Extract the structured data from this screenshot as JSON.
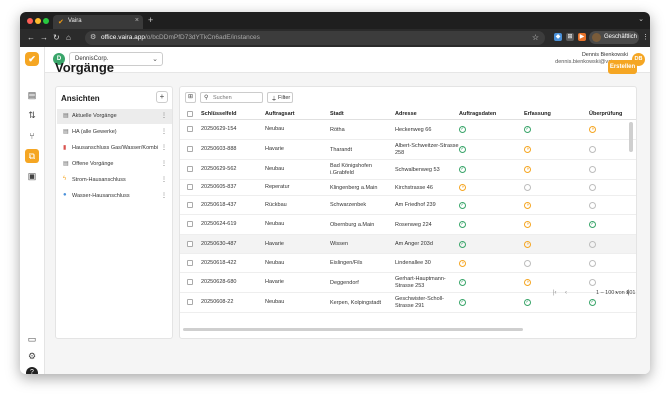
{
  "browser": {
    "tab_title": "Vaira",
    "url_host": "office.vaira.app",
    "url_path": "/o/bcDDmPfD73dYTkCn6adE/instances",
    "profile_label": "Geschäftlich"
  },
  "app": {
    "org_initial": "D",
    "org_name": "DennisCorp.",
    "user_name": "Dennis Bienkowski",
    "user_email": "dennis.bienkowski@vaira.app",
    "user_initials": "DB",
    "page_title": "Vorgänge",
    "create_label": "Erstellen"
  },
  "views": {
    "title": "Ansichten",
    "items": [
      {
        "label": "Aktuelle Vorgänge",
        "icon": "table-icon"
      },
      {
        "label": "HA (alle Gewerke)",
        "icon": "table-icon"
      },
      {
        "label": "Hausanschluss Gas/Wasser/Kombi",
        "icon": "utility-icon"
      },
      {
        "label": "Offene Vorgänge",
        "icon": "table-icon"
      },
      {
        "label": "Strom-Hausanschluss",
        "icon": "bolt-icon"
      },
      {
        "label": "Wasser-Hausanschluss",
        "icon": "drop-icon"
      }
    ]
  },
  "table": {
    "search_placeholder": "Suchen",
    "filter_label": "Filter",
    "columns": [
      "Schlüsselfeld",
      "Auftragsart",
      "Stadt",
      "Adresse",
      "Auftragsdaten",
      "Erfassung",
      "Überprüfung"
    ],
    "rows": [
      {
        "key": "20250629-154",
        "type": "Neubau",
        "city": [
          "Rötha"
        ],
        "address": [
          "Heckenweg 66"
        ],
        "s1": "done",
        "s2": "done",
        "s3": "progress"
      },
      {
        "key": "20250603-888",
        "type": "Havarie",
        "city": [
          "Tharandt"
        ],
        "address": [
          "Albert-Schweitzer-Strasse",
          "258"
        ],
        "s1": "done",
        "s2": "progress",
        "s3": "open"
      },
      {
        "key": "20250629-562",
        "type": "Neubau",
        "city": [
          "Bad Königshofen",
          "i.Grabfeld"
        ],
        "address": [
          "Schwalbenweg 53"
        ],
        "s1": "done",
        "s2": "progress",
        "s3": "open"
      },
      {
        "key": "20250605-837",
        "type": "Reperatur",
        "city": [
          "Klingenberg a.Main"
        ],
        "address": [
          "Kirchstrasse 46"
        ],
        "s1": "progress",
        "s2": "open",
        "s3": "open"
      },
      {
        "key": "20250618-437",
        "type": "Rückbau",
        "city": [
          "Schwarzenbek"
        ],
        "address": [
          "Am Friedhof 239"
        ],
        "s1": "done",
        "s2": "progress",
        "s3": "open"
      },
      {
        "key": "20250624-619",
        "type": "Neubau",
        "city": [
          "Obernburg a.Main"
        ],
        "address": [
          "Rosenweg 224"
        ],
        "s1": "done",
        "s2": "progress",
        "s3": "done"
      },
      {
        "key": "20250630-487",
        "type": "Havarie",
        "city": [
          "Wissen"
        ],
        "address": [
          "Am Anger 203d"
        ],
        "s1": "done",
        "s2": "progress",
        "s3": "open"
      },
      {
        "key": "20250618-422",
        "type": "Neubau",
        "city": [
          "Eislingen/Fils"
        ],
        "address": [
          "Lindenallee 30"
        ],
        "s1": "progress",
        "s2": "open",
        "s3": "open"
      },
      {
        "key": "20250628-680",
        "type": "Havarie",
        "city": [
          "Deggendorf"
        ],
        "address": [
          "Gerhart-Hauptmann-",
          "Strasse 253"
        ],
        "s1": "done",
        "s2": "progress",
        "s3": "open"
      },
      {
        "key": "20250608-22",
        "type": "Neubau",
        "city": [
          "Kerpen, Kolpingstadt"
        ],
        "address": [
          "Geschwister-Scholl-",
          "Strasse 291"
        ],
        "s1": "done",
        "s2": "done",
        "s3": "done"
      }
    ],
    "pagination": "1 – 100 von 101"
  },
  "colors": {
    "accent": "#f5a623",
    "done": "#3aa56a",
    "open": "#bdbdbd"
  }
}
